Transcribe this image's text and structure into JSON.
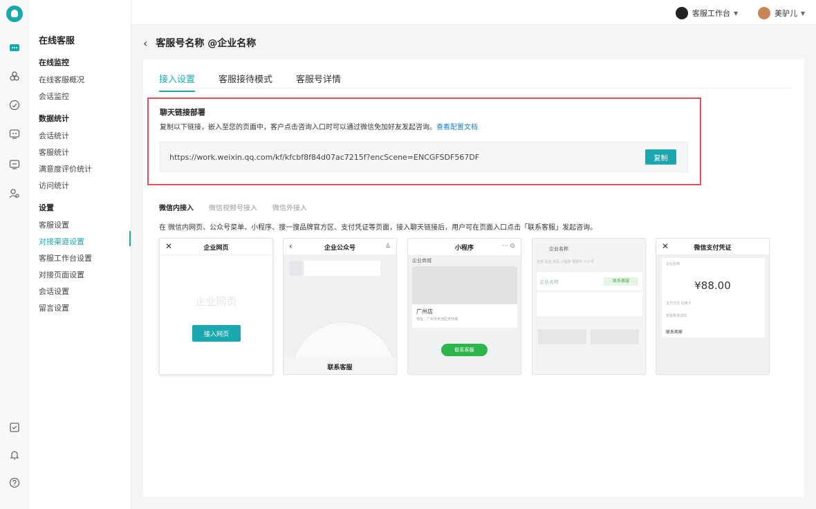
{
  "topbar": {
    "workbench_label": "客服工作台",
    "user_name": "美驴儿"
  },
  "menu": {
    "title": "在线客服",
    "groups": [
      {
        "label": "在线监控",
        "items": [
          "在线客服概况",
          "会话监控"
        ]
      },
      {
        "label": "数据统计",
        "items": [
          "会话统计",
          "客服统计",
          "满意度评价统计",
          "访问统计"
        ]
      },
      {
        "label": "设置",
        "items": [
          "客服设置",
          "对接渠道设置",
          "客服工作台设置",
          "对接页面设置",
          "会话设置",
          "留言设置"
        ]
      }
    ],
    "active_item": "对接渠道设置"
  },
  "page": {
    "title": "客服号名称 @企业名称"
  },
  "tabs": [
    "接入设置",
    "客服接待模式",
    "客服号详情"
  ],
  "active_tab": "接入设置",
  "chat_link": {
    "title": "聊天链接部署",
    "desc": "复制以下链接，嵌入至您的页面中，客户点击咨询入口时可以通过微信免加好友发起咨询。",
    "doc_link": "查看配置文档",
    "url": "https://work.weixin.qq.com/kf/kfcbf8f84d07ac7215f?encScene=ENCGFSDF567DF",
    "copy_label": "复制"
  },
  "subtabs": [
    "微信内接入",
    "微信视频号接入",
    "微信外接入"
  ],
  "active_subtab": "微信内接入",
  "intro": "在 微信内网页、公众号菜单、小程序、搜一搜品牌官方区、支付凭证等页面，接入聊天链接后，用户可在页面入口点击「联系客服」发起咨询。",
  "previews": {
    "web": {
      "title": "企业网页",
      "watermark": "企业网页",
      "button": "接入网页"
    },
    "official": {
      "title": "企业公众号",
      "contact": "联系客服"
    },
    "mini": {
      "title": "小程序",
      "shop": "企业商城",
      "store": "广州店",
      "address": "地址：广州市天河区天环城",
      "button": "联系客服"
    },
    "search": {
      "title": "企业名称",
      "tabs": "全部  消息  商品  小程序  视频号  公众号",
      "name": "企业名称",
      "link": "联系客服"
    },
    "pay": {
      "title": "微信支付凭证",
      "shop": "企业名称",
      "amount": "¥88.00",
      "method": "支付方式  信用卡",
      "detail": "查看账单详情",
      "merchant": "联系商家"
    }
  },
  "colors": {
    "accent": "#1aa8b0",
    "highlight_border": "#e54d57",
    "link": "#1a7ec9",
    "wechat_green": "#2bb54a"
  }
}
